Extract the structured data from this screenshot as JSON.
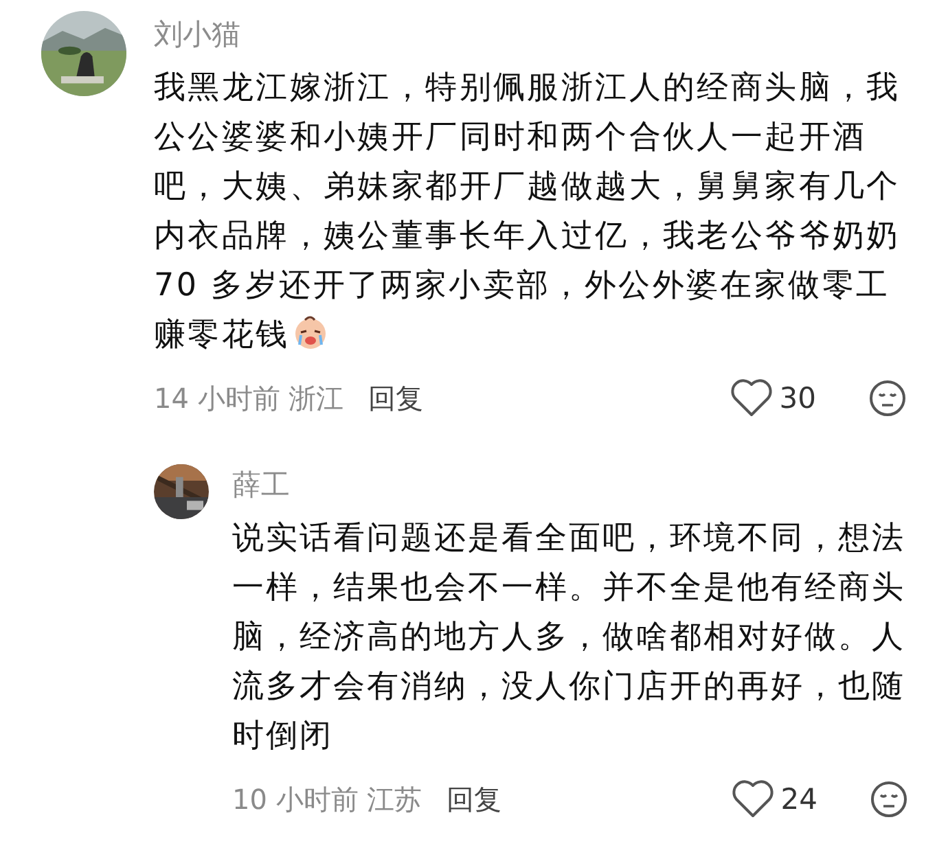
{
  "comments": [
    {
      "user": "刘小猫",
      "text": "我黑龙江嫁浙江，特别佩服浙江人的经商头脑，我公公婆婆和小姨开厂同时和两个合伙人一起开酒吧，大姨、弟妹家都开厂越做越大，舅舅家有几个内衣品牌，姨公董事长年入过亿，我老公爷爷奶奶70 多岁还开了两家小卖部，外公外婆在家做零工赚零花钱",
      "trailing_emoji": true,
      "time": "14 小时前",
      "location": "浙江",
      "reply_label": "回复",
      "likes": "30",
      "liked": false,
      "replies": [
        {
          "user": "薛工",
          "text": "说实话看问题还是看全面吧，环境不同，想法一样，结果也会不一样。并不全是他有经商头脑，经济高的地方人多，做啥都相对好做。人流多才会有消纳，没人你门店开的再好，也随时倒闭",
          "time": "10 小时前",
          "location": "江苏",
          "reply_label": "回复",
          "likes": "24",
          "liked": false
        }
      ]
    }
  ]
}
